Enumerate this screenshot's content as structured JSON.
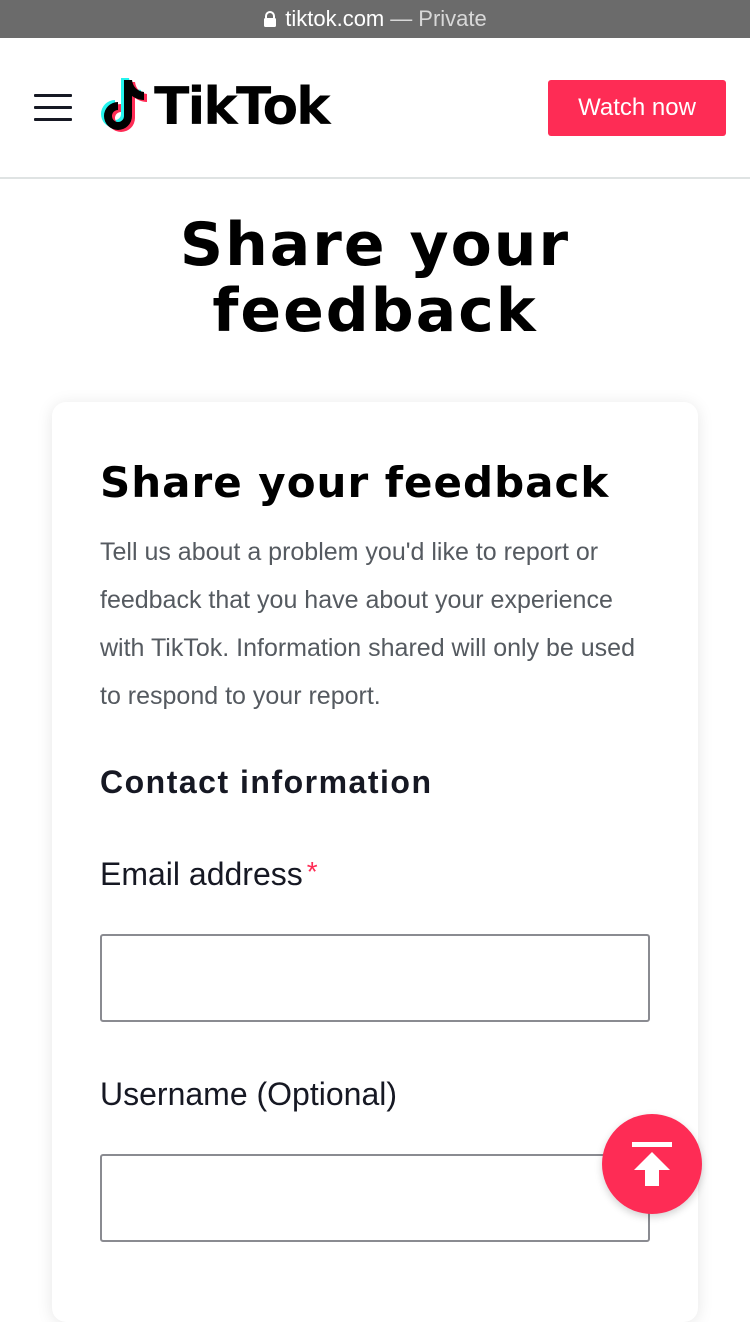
{
  "browser": {
    "domain": "tiktok.com",
    "separator": "—",
    "mode": "Private"
  },
  "header": {
    "logo_text": "TikTok",
    "watch_now_label": "Watch now"
  },
  "page": {
    "title": "Share your feedback"
  },
  "form": {
    "title": "Share your feedback",
    "description": "Tell us about a problem you'd like to report or feedback that you have about your experience with TikTok. Information shared will only be used to respond to your report.",
    "section_title": "Contact information",
    "email_label": "Email address",
    "required_mark": "*",
    "email_value": "",
    "username_label": "Username (Optional)",
    "username_value": ""
  },
  "colors": {
    "brand": "#fe2c55",
    "url_bar": "#6b6b6b",
    "text_dark": "#161823",
    "text_muted": "#555a60"
  },
  "icons": {
    "lock": "lock-icon",
    "menu": "hamburger-menu-icon",
    "logo": "tiktok-note-icon",
    "scroll_top": "arrow-up-to-top-icon"
  }
}
